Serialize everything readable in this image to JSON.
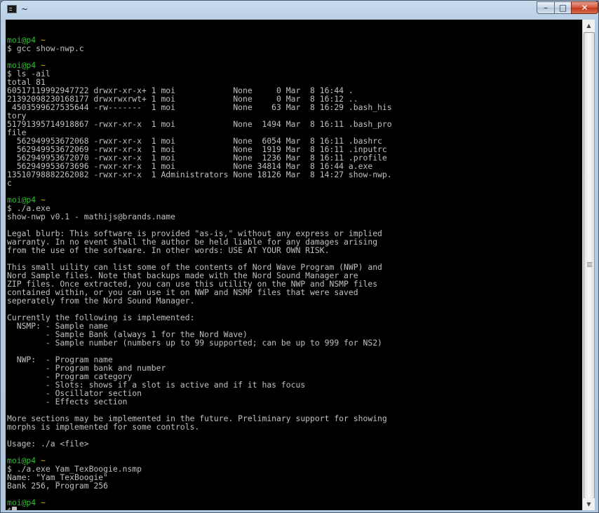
{
  "window": {
    "title": "~",
    "icon": "terminal-icon",
    "controls": {
      "minimize": "minimize-icon",
      "maximize": "maximize-icon",
      "close": "close-icon"
    }
  },
  "terminal": {
    "prompt": {
      "user_host": "moi@p4",
      "path": "~"
    },
    "lines": [
      "",
      "moi@p4 ~",
      "$ gcc show-nwp.c",
      "",
      "moi@p4 ~",
      "$ ls -ail",
      "total 81",
      "60517119992947722 drwxr-xr-x+ 1 moi            None     0 Mar  8 16:44 .",
      "21392098230168177 drwxrwxrwt+ 1 moi            None     0 Mar  8 16:12 ..",
      " 4503599627535644 -rw-------  1 moi            None    63 Mar  8 16:29 .bash_his",
      "tory",
      "51791395714918867 -rwxr-xr-x  1 moi            None  1494 Mar  8 16:11 .bash_pro",
      "file",
      "  562949953672068 -rwxr-xr-x  1 moi            None  6054 Mar  8 16:11 .bashrc",
      "  562949953672069 -rwxr-xr-x  1 moi            None  1919 Mar  8 16:11 .inputrc",
      "  562949953672070 -rwxr-xr-x  1 moi            None  1236 Mar  8 16:11 .profile",
      "  562949953673696 -rwxr-xr-x  1 moi            None 34814 Mar  8 16:44 a.exe",
      "13510798882262082 -rwxr-xr-x  1 Administrators None 18126 Mar  8 14:27 show-nwp.",
      "c",
      "",
      "moi@p4 ~",
      "$ ./a.exe",
      "show-nwp v0.1 - mathijs@brands.name",
      "",
      "Legal blurb: This software is provided \"as-is,\" without any express or implied",
      "warranty. In no event shall the author be held liable for any damages arising",
      "from the use of the software. In other words: USE AT YOUR OWN RISK.",
      "",
      "This small uility can list some of the contents of Nord Wave Program (NWP) and",
      "Nord Sample files. Note that backups made with the Nord Sound Manager are",
      "ZIP files. Once extracted, you can use this utility on the NWP and NSMP files",
      "contained within, or you can use it on NWP and NSMP files that were saved",
      "seperately from the Nord Sound Manager.",
      "",
      "Currently the following is implemented:",
      "  NSMP: - Sample name",
      "        - Sample Bank (always 1 for the Nord Wave)",
      "        - Sample number (numbers up to 99 supported; can be up to 999 for NS2)",
      "",
      "  NWP:  - Program name",
      "        - Program bank and number",
      "        - Program category",
      "        - Slots: shows if a slot is active and if it has focus",
      "        - Oscillator section",
      "        - Effects section",
      "",
      "More sections may be implemented in the future. Preliminary support for showing",
      "morphs is implemented for some controls.",
      "",
      "Usage: ./a <file>",
      "",
      "moi@p4 ~",
      "$ ./a.exe Yam_TexBoogie.nsmp",
      "Name: \"Yam_TexBoogie\"",
      "Bank 256, Program 256",
      "",
      "moi@p4 ~",
      "$"
    ],
    "colors": {
      "background": "#000000",
      "text": "#c0c0c0",
      "prompt_user": "#2fbf2f",
      "prompt_path": "#c8b400"
    }
  },
  "scrollbar": {
    "up": "scroll-up-arrow-icon",
    "down": "scroll-down-arrow-icon"
  }
}
